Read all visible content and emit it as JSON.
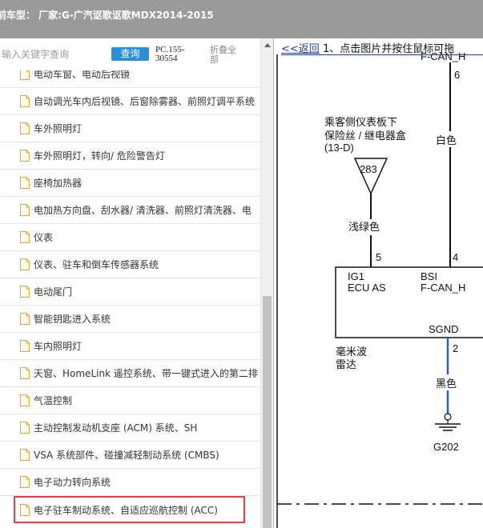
{
  "header": {
    "title": "前车型： 厂家:G-广汽讴歌讴歌MDX2014-2015"
  },
  "search": {
    "placeholder": "输入关键字查询",
    "button_label": "查询",
    "pc_code": "PC.155-30554",
    "fold_all_label": "折叠全部"
  },
  "tree": {
    "items": [
      {
        "label": "电动车窗、电动后视镜"
      },
      {
        "label": "自动调光车内后视镜、后窗除雾器、前照灯调平系统"
      },
      {
        "label": "车外照明灯"
      },
      {
        "label": "车外照明灯，转向/ 危险警告灯"
      },
      {
        "label": "座椅加热器"
      },
      {
        "label": "电加热方向盘、刮水器/ 清洗器、前照灯清洗器、电"
      },
      {
        "label": "仪表"
      },
      {
        "label": "仪表、驻车和倒车传感器系统"
      },
      {
        "label": "电动尾门"
      },
      {
        "label": "智能钥匙进入系统"
      },
      {
        "label": "车内照明灯"
      },
      {
        "label": "天窗、HomeLink 遥控系统、带一键式进入的第二排"
      },
      {
        "label": "气温控制"
      },
      {
        "label": "主动控制发动机支座 (ACM) 系统、SH"
      },
      {
        "label": "VSA 系统部件、碰撞减轻制动系统 (CMBS)"
      },
      {
        "label": "电子动力转向系统"
      },
      {
        "label": "电子驻车制动系统、自适应巡航控制 (ACC)"
      }
    ],
    "selected_index": 16
  },
  "viewer": {
    "back_link": "<<返回",
    "instruction": "1、点击图片并按住鼠标可拖"
  },
  "diagram": {
    "top_label": "F-CAN_H",
    "pin_top": "6",
    "wire_white": "白色",
    "fuse_box_label_1": "乘客侧仪表板下",
    "fuse_box_label_2": "保险丝 / 继电器盒",
    "fuse_box_label_3": "(13-D)",
    "fuse_number": "283",
    "wire_light_green": "浅绿色",
    "pin_ig1": "5",
    "pin_bsi": "4",
    "ecu_ig1": "IG1",
    "ecu_ig1_sub": "ECU AS",
    "ecu_bsi": "BSI",
    "ecu_bsi_sub": "F-CAN_H",
    "ecu_sgnd": "SGND",
    "pin_sgnd": "2",
    "module_name_1": "毫米波",
    "module_name_2": "雷达",
    "wire_black": "黑色",
    "ground_label": "G202",
    "colors": {
      "ground_wire": "#2f5fb3",
      "line": "#111111"
    }
  }
}
